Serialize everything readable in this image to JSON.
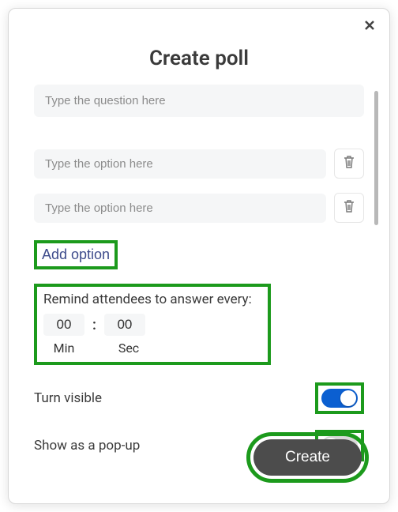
{
  "title": "Create poll",
  "question": {
    "placeholder": "Type the question here",
    "value": ""
  },
  "options": [
    {
      "placeholder": "Type the option here",
      "value": ""
    },
    {
      "placeholder": "Type the option here",
      "value": ""
    }
  ],
  "add_option_label": "Add option",
  "remind": {
    "title": "Remind attendees to answer every:",
    "min_value": "00",
    "sec_value": "00",
    "min_label": "Min",
    "sec_label": "Sec",
    "colon": ":"
  },
  "turn_visible": {
    "label": "Turn visible",
    "on": true
  },
  "popup": {
    "label": "Show as a pop-up",
    "on": false
  },
  "create_label": "Create"
}
